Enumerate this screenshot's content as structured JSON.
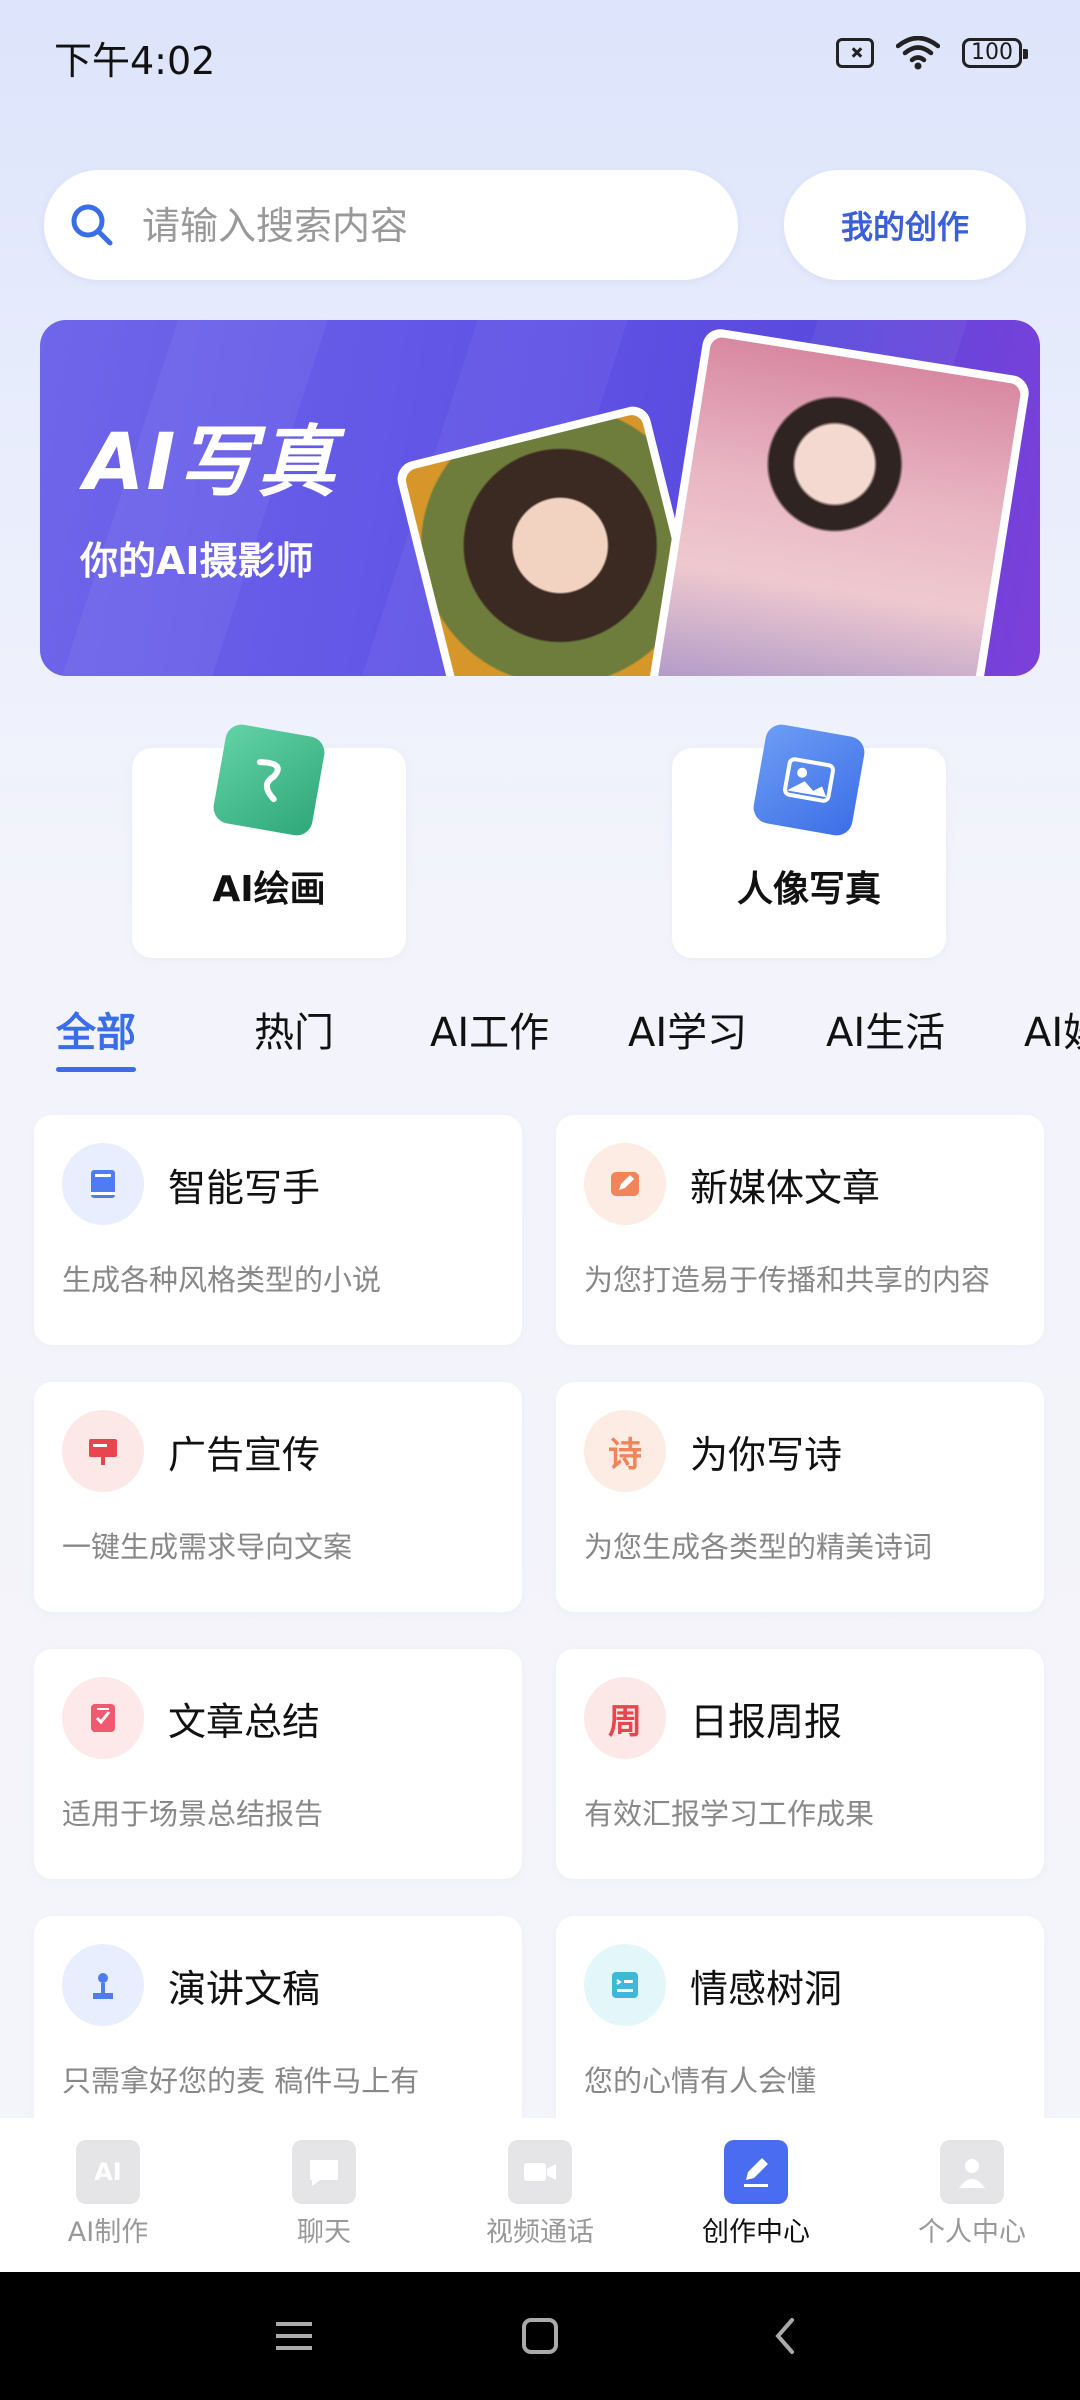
{
  "status": {
    "time": "下午4:02",
    "battery": "100"
  },
  "search": {
    "placeholder": "请输入搜索内容"
  },
  "my_creation_label": "我的创作",
  "banner": {
    "title": "AI写真",
    "subtitle": "你的AI摄影师"
  },
  "features": [
    {
      "label": "AI绘画",
      "icon": "brush-icon"
    },
    {
      "label": "人像写真",
      "icon": "image-icon"
    }
  ],
  "tabs": [
    "全部",
    "热门",
    "AI工作",
    "AI学习",
    "AI生活",
    "AI娱"
  ],
  "active_tab": 0,
  "cards": [
    {
      "title": "智能写手",
      "desc": "生成各种风格类型的小说",
      "icon": "book-icon",
      "color": "#4f7cf0",
      "bg": "#e8eefd"
    },
    {
      "title": "新媒体文章",
      "desc": "为您打造易于传播和共享的内容",
      "icon": "edit-icon",
      "color": "#f2845a",
      "bg": "#fdece4"
    },
    {
      "title": "广告宣传",
      "desc": "一键生成需求导向文案",
      "icon": "billboard-icon",
      "color": "#e8464e",
      "bg": "#fde8e8"
    },
    {
      "title": "为你写诗",
      "desc": "为您生成各类型的精美诗词",
      "icon": "poem-icon",
      "glyph": "诗",
      "color": "#f2845a",
      "bg": "#fdece4"
    },
    {
      "title": "文章总结",
      "desc": "适用于场景总结报告",
      "icon": "summary-icon",
      "color": "#ef5a6e",
      "bg": "#fde8ea"
    },
    {
      "title": "日报周报",
      "desc": "有效汇报学习工作成果",
      "icon": "week-icon",
      "glyph": "周",
      "color": "#e8464e",
      "bg": "#fde8e8"
    },
    {
      "title": "演讲文稿",
      "desc": "只需拿好您的麦 稿件马上有",
      "icon": "speech-icon",
      "color": "#4f7cf0",
      "bg": "#e8eefd"
    },
    {
      "title": "情感树洞",
      "desc": "您的心情有人会懂",
      "icon": "emotion-icon",
      "color": "#3fb8d8",
      "bg": "#e3f6fa"
    }
  ],
  "nav": [
    {
      "label": "AI制作",
      "icon": "ai-book-icon"
    },
    {
      "label": "聊天",
      "icon": "chat-icon"
    },
    {
      "label": "视频通话",
      "icon": "video-icon"
    },
    {
      "label": "创作中心",
      "icon": "pen-icon",
      "active": true
    },
    {
      "label": "个人中心",
      "icon": "person-icon"
    }
  ],
  "colors": {
    "accent": "#3a6ee8",
    "banner": "#5f53e6"
  }
}
